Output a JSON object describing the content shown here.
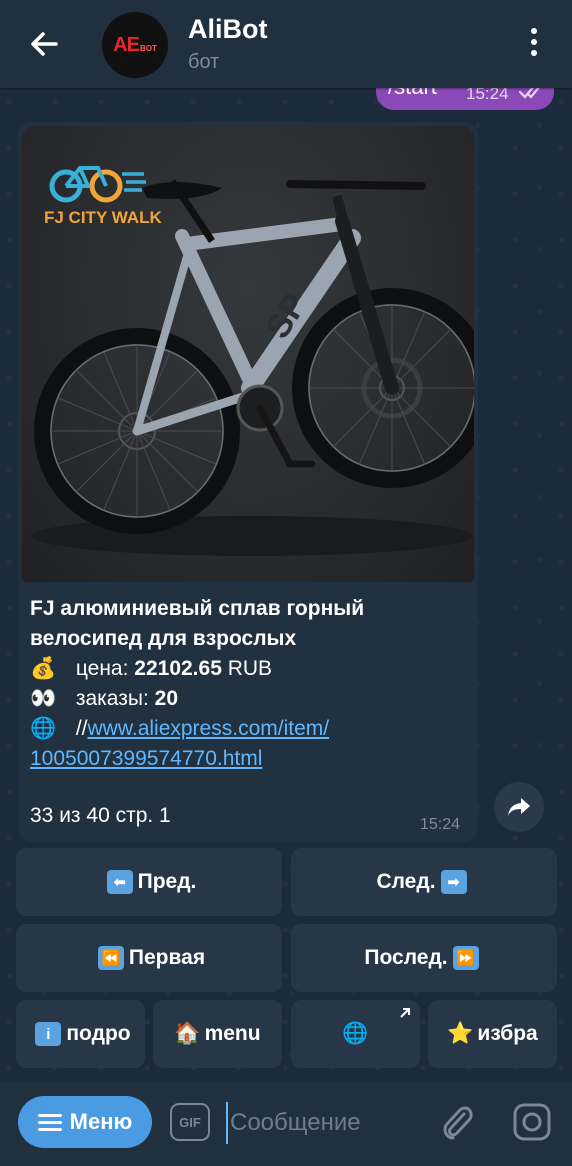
{
  "header": {
    "title": "AliBot",
    "subtitle": "бот",
    "avatar_text": "AE",
    "avatar_sub": "BOT"
  },
  "outgoing": {
    "text": "/start",
    "time": "15:24"
  },
  "message": {
    "image_logo_text": "FJ CITY WALK",
    "title": "FJ алюминиевый сплав горный велосипед для взрослых",
    "price_emoji": "💰",
    "price_label": "цена:",
    "price_value": "22102.65",
    "price_currency": "RUB",
    "orders_emoji": "👀",
    "orders_label": "заказы:",
    "orders_value": "20",
    "link_emoji": "🌐",
    "link_prefix": "//",
    "link_line1": "www.aliexpress.com/item/",
    "link_line2": "1005007399574770.html",
    "page_info": "33 из 40 стр. 1",
    "time": "15:24"
  },
  "keyboard": {
    "prev": "Пред.",
    "next": "След.",
    "first": "Первая",
    "last": "Послед.",
    "details": "подро",
    "menu": "menu",
    "favorites": "избра"
  },
  "bottom": {
    "menu_label": "Меню",
    "gif_label": "GIF",
    "input_placeholder": "Сообщение"
  },
  "colors": {
    "accent": "#4b9be3",
    "link": "#5fb8ff",
    "outgoing_bubble": "#8b49b8",
    "background": "#1c2b3b"
  }
}
